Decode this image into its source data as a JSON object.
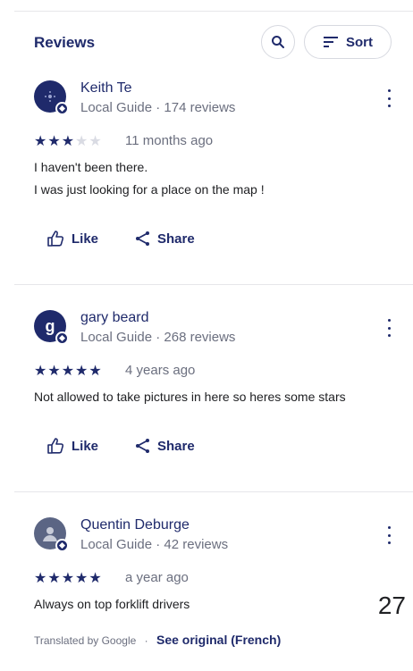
{
  "header": {
    "title": "Reviews",
    "sort_label": "Sort"
  },
  "reviews": [
    {
      "avatar_text": "",
      "name": "Keith Te",
      "meta": "Local Guide · 174 reviews",
      "rating": 3,
      "when": "11 months ago",
      "lines": [
        "I haven't been there.",
        "I was just looking for a place on the map !"
      ],
      "like_label": "Like",
      "share_label": "Share"
    },
    {
      "avatar_text": "g",
      "name": "gary beard",
      "meta": "Local Guide · 268 reviews",
      "rating": 5,
      "when": "4 years ago",
      "lines": [
        "Not allowed to take pictures in here so heres some stars"
      ],
      "like_label": "Like",
      "share_label": "Share"
    },
    {
      "avatar_text": "",
      "name": "Quentin Deburge",
      "meta": "Local Guide · 42 reviews",
      "rating": 5,
      "when": "a year ago",
      "lines": [
        "Always on top forklift drivers"
      ]
    }
  ],
  "translation": {
    "note": "Translated by Google",
    "dot": "·",
    "see_original": "See original (French)"
  },
  "page_number": "27",
  "icons": [
    "search-icon",
    "sort-icon",
    "more-vert-icon",
    "thumb-up-icon",
    "share-icon",
    "local-guide-badge-icon",
    "star-icon"
  ],
  "colors": {
    "accent": "#1f2a6b",
    "muted": "#6b6f7f",
    "star_off": "#d9dbe3",
    "divider": "#e6e6ea"
  }
}
